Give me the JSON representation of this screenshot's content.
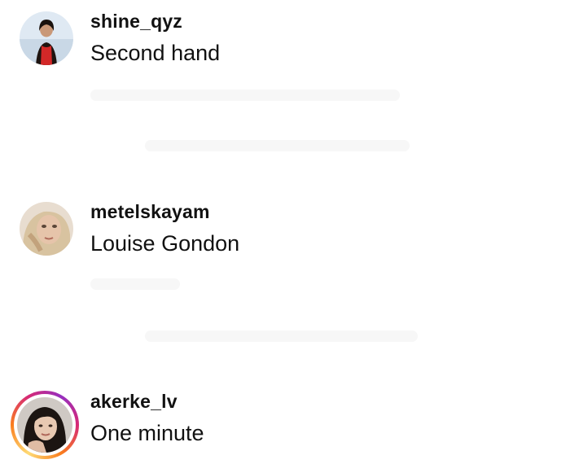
{
  "comments": [
    {
      "username": "shine_qyz",
      "text": "Second hand",
      "avatar": "user-avatar-photo",
      "has_story": false
    },
    {
      "username": "metelskayam",
      "text": "Louise Gondon",
      "avatar": "user-avatar-photo",
      "has_story": false
    },
    {
      "username": "akerke_lv",
      "text": "One minute",
      "avatar": "user-avatar-photo",
      "has_story": true
    }
  ],
  "colors": {
    "text": "#111111",
    "background": "#ffffff",
    "story_ring": [
      "#feda75",
      "#fa7e1e",
      "#d62976",
      "#962fbf"
    ]
  }
}
